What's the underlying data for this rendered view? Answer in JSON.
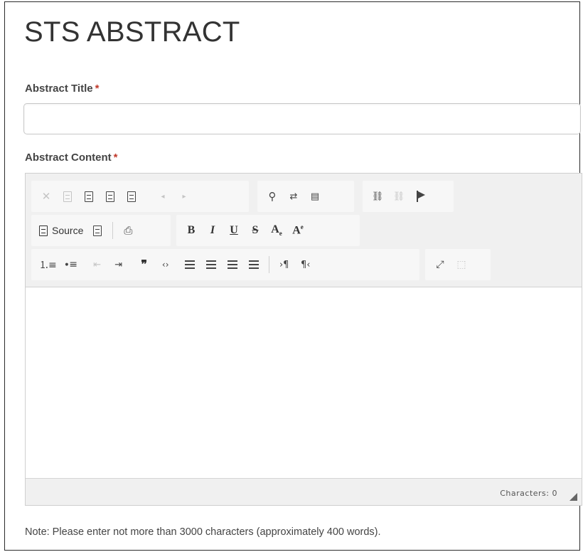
{
  "page": {
    "title": "STS ABSTRACT"
  },
  "form": {
    "title_field": {
      "label": "Abstract Title",
      "required_marker": "*",
      "value": ""
    },
    "content_field": {
      "label": "Abstract Content",
      "required_marker": "*"
    }
  },
  "editor": {
    "toolbar_row1": [
      {
        "name": "cut-button",
        "glyph": "✕",
        "enabled": false
      },
      {
        "name": "copy-button",
        "glyph": "doc",
        "enabled": false
      },
      {
        "name": "paste-button",
        "glyph": "doc",
        "enabled": true
      },
      {
        "name": "paste-text-button",
        "glyph": "doc",
        "enabled": true
      },
      {
        "name": "paste-word-button",
        "glyph": "doc",
        "enabled": true
      },
      {
        "name": "undo-button",
        "glyph": "◂",
        "enabled": false
      },
      {
        "name": "redo-button",
        "glyph": "▸",
        "enabled": false
      },
      {
        "name": "find-button",
        "glyph": "🔍︎",
        "enabled": true
      },
      {
        "name": "replace-button",
        "glyph": "⇄",
        "enabled": true
      },
      {
        "name": "select-all-button",
        "glyph": "▤",
        "enabled": true
      },
      {
        "name": "link-button",
        "glyph": "🔗︎",
        "enabled": true
      },
      {
        "name": "unlink-button",
        "glyph": "⛓",
        "enabled": false
      },
      {
        "name": "anchor-button",
        "glyph": "flag",
        "enabled": true
      }
    ],
    "source_label": "Source",
    "toolbar_row2_format": [
      {
        "name": "bold-button",
        "glyph": "B"
      },
      {
        "name": "italic-button",
        "glyph": "I"
      },
      {
        "name": "underline-button",
        "glyph": "U"
      },
      {
        "name": "strike-button",
        "glyph": "S"
      },
      {
        "name": "subscript-button",
        "glyph": "Aₑ"
      },
      {
        "name": "superscript-button",
        "glyph": "Aᵉ"
      }
    ],
    "toolbar_row3": [
      {
        "name": "numbered-list-button",
        "glyph": "1≡"
      },
      {
        "name": "bulleted-list-button",
        "glyph": "•≡"
      },
      {
        "name": "outdent-button",
        "glyph": "⇤"
      },
      {
        "name": "indent-button",
        "glyph": "⇥"
      },
      {
        "name": "blockquote-button",
        "glyph": "99"
      },
      {
        "name": "code-button",
        "glyph": "‹›"
      },
      {
        "name": "align-left-button",
        "glyph": "align"
      },
      {
        "name": "align-center-button",
        "glyph": "align"
      },
      {
        "name": "align-right-button",
        "glyph": "align"
      },
      {
        "name": "justify-button",
        "glyph": "align"
      },
      {
        "name": "ltr-button",
        "glyph": "›¶"
      },
      {
        "name": "rtl-button",
        "glyph": "¶‹"
      },
      {
        "name": "maximize-button",
        "glyph": "⤢"
      },
      {
        "name": "show-blocks-button",
        "glyph": "⬚"
      }
    ],
    "status": {
      "characters_label": "Characters: 0"
    }
  },
  "note": "Note: Please enter not more than 3000 characters (approximately 400 words)."
}
